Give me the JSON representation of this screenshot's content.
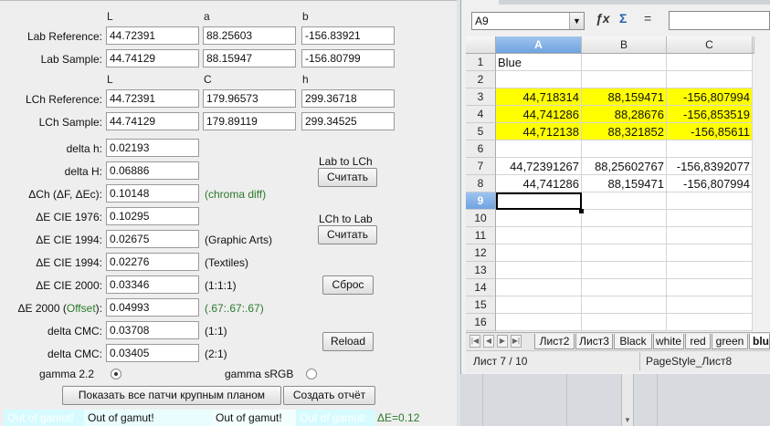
{
  "calc": {
    "lab_headers": [
      "L",
      "a",
      "b"
    ],
    "lch_headers": [
      "L",
      "C",
      "h"
    ],
    "lab_reference": {
      "label": "Lab Reference:",
      "values": [
        "44.72391",
        "88.25603",
        "-156.83921"
      ]
    },
    "lab_sample": {
      "label": "Lab Sample:",
      "values": [
        "44.74129",
        "88.15947",
        "-156.80799"
      ]
    },
    "lch_reference": {
      "label": "LCh Reference:",
      "values": [
        "44.72391",
        "179.96573",
        "299.36718"
      ]
    },
    "lch_sample": {
      "label": "LCh Sample:",
      "values": [
        "44.74129",
        "179.89119",
        "299.34525"
      ]
    },
    "metrics": [
      {
        "label": "delta h:",
        "value": "0.02193",
        "note": ""
      },
      {
        "label": "delta H:",
        "value": "0.06886",
        "note": ""
      },
      {
        "label": "ΔCh (ΔF, ΔEc):",
        "value": "0.10148",
        "note": "(chroma diff)"
      },
      {
        "label": "ΔE CIE 1976:",
        "value": "0.10295",
        "note": ""
      },
      {
        "label": "ΔE CIE 1994:",
        "value": "0.02675",
        "note": "(Graphic Arts)"
      },
      {
        "label": "ΔE CIE 1994:",
        "value": "0.02276",
        "note": "(Textiles)"
      },
      {
        "label": "ΔE CIE 2000:",
        "value": "0.03346",
        "note": "(1:1:1)"
      },
      {
        "label_prefix": "ΔE 2000 (",
        "label_green": "Offset",
        "label_suffix": "):",
        "value": "0.04993",
        "note": "(.67:.67:.67)"
      },
      {
        "label": "delta CMC:",
        "value": "0.03708",
        "note": "(1:1)"
      },
      {
        "label": "delta CMC:",
        "value": "0.03405",
        "note": "(2:1)"
      }
    ],
    "lab_to_lch_label": "Lab to LCh",
    "lch_to_lab_label": "LCh to Lab",
    "calc_button": "Считать",
    "reset_button": "Сброс",
    "reload_button": "Reload",
    "gamma22_label": "gamma 2.2",
    "gamma_srgb_label": "gamma sRGB",
    "gamma_selected": "gamma 2.2",
    "show_patches_button": "Показать все патчи крупным планом",
    "create_report_button": "Создать отчёт",
    "gamut_left_faded": "Out of gamut!",
    "gamut_left": "Out of gamut!",
    "gamut_right": "Out of gamut!",
    "gamut_right_faded": "Out of gamut!",
    "delta_e_footer": "ΔE=0.12"
  },
  "sheet": {
    "name_box": "A9",
    "columns": [
      "A",
      "B",
      "C"
    ],
    "selected_column": "A",
    "rows": [
      "1",
      "2",
      "3",
      "4",
      "5",
      "6",
      "7",
      "8",
      "9",
      "10",
      "11",
      "12",
      "13",
      "14",
      "15",
      "16"
    ],
    "selected_row": "9",
    "cells": {
      "A1": "Blue",
      "A3": "44,718314",
      "B3": "88,159471",
      "C3": "-156,807994",
      "A4": "44,741286",
      "B4": "88,28676",
      "C4": "-156,853519",
      "A5": "44,712138",
      "B5": "88,321852",
      "C5": "-156,85611",
      "A7": "44,72391267",
      "B7": "88,25602767",
      "C7": "-156,8392077",
      "A8": "44,741286",
      "B8": "88,159471",
      "C8": "-156,807994"
    },
    "tabs": [
      "Лист2",
      "Лист3",
      "Black",
      "white",
      "red",
      "green",
      "blue"
    ],
    "active_tab": "blue",
    "status_sheet": "Лист 7 / 10",
    "status_pagestyle": "PageStyle_Лист8",
    "colors": {
      "highlight": "#ffff00",
      "selection": "#6fa3e0"
    }
  }
}
